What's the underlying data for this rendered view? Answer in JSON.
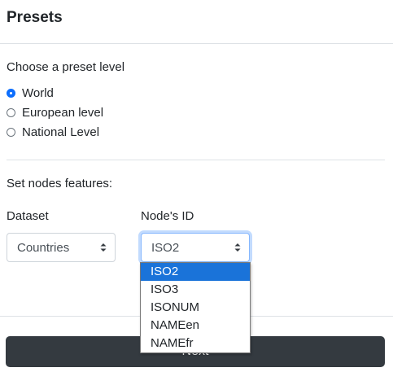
{
  "header": {
    "title": "Presets"
  },
  "preset": {
    "label": "Choose a preset level",
    "options": [
      {
        "label": "World",
        "checked": true
      },
      {
        "label": "European level",
        "checked": false
      },
      {
        "label": "National Level",
        "checked": false
      }
    ]
  },
  "nodes": {
    "label": "Set nodes features:",
    "dataset": {
      "label": "Dataset",
      "value": "Countries"
    },
    "node_id": {
      "label": "Node's ID",
      "value": "ISO2",
      "options": [
        "ISO2",
        "ISO3",
        "ISONUM",
        "NAMEen",
        "NAMEfr"
      ],
      "selected_index": 0
    }
  },
  "footer": {
    "next_label": "Next"
  },
  "colors": {
    "accent": "#0d6efd",
    "button_bg": "#343a40",
    "dropdown_selected": "#1a73d9"
  }
}
